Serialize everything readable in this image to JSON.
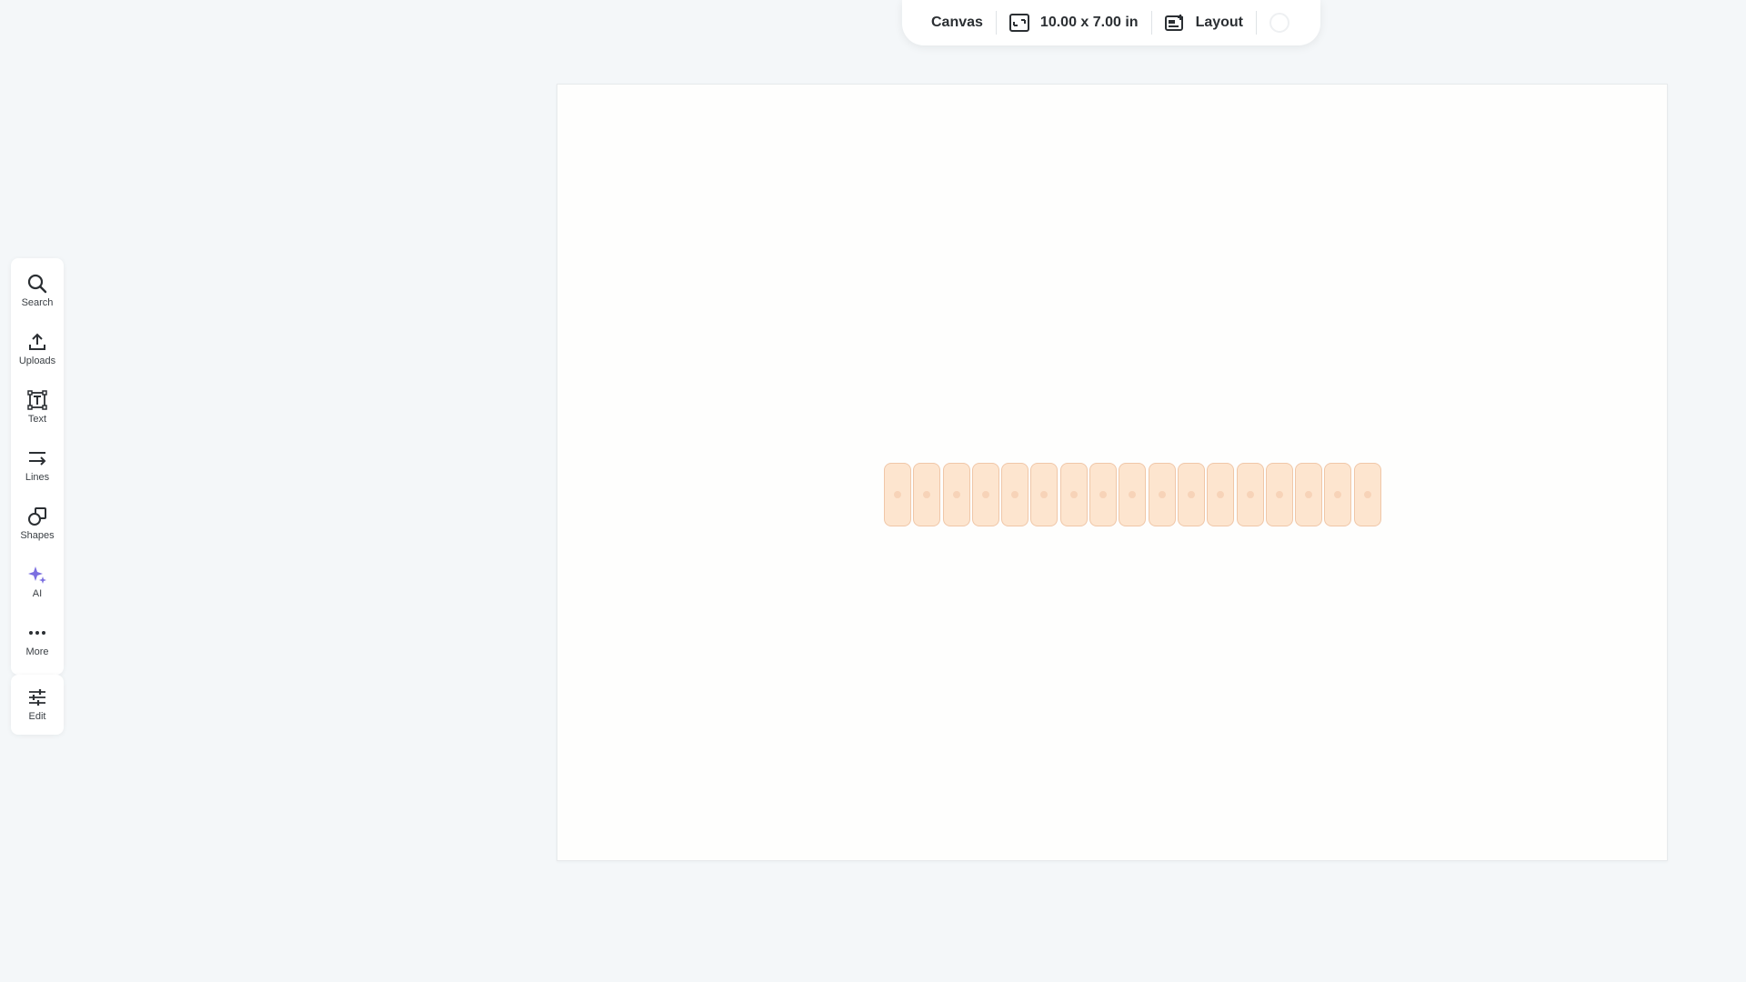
{
  "toolbar": {
    "canvas_label": "Canvas",
    "size_label": "10.00 x 7.00 in",
    "layout_label": "Layout"
  },
  "sidebar": {
    "items": [
      {
        "label": "Search",
        "icon": "search-icon"
      },
      {
        "label": "Uploads",
        "icon": "upload-icon"
      },
      {
        "label": "Text",
        "icon": "text-icon"
      },
      {
        "label": "Lines",
        "icon": "lines-icon"
      },
      {
        "label": "Shapes",
        "icon": "shapes-icon"
      },
      {
        "label": "AI",
        "icon": "sparkle-icon"
      },
      {
        "label": "More",
        "icon": "more-icon"
      }
    ],
    "edit": {
      "label": "Edit",
      "icon": "sliders-icon"
    }
  },
  "canvas": {
    "cell_count": 17,
    "colors": {
      "background": "#f4f7f9",
      "page": "#fefefd",
      "cell_fill": "#fde5cf",
      "cell_border": "#f0c7a8",
      "ai_accent": "#7b6fe0"
    }
  }
}
